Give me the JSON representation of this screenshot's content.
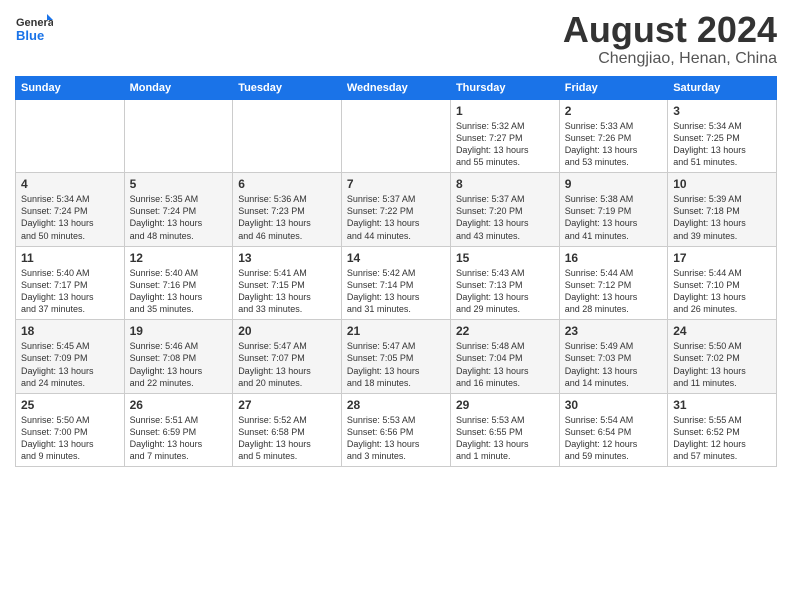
{
  "header": {
    "logo": {
      "general": "General",
      "blue": "Blue"
    },
    "title": "August 2024",
    "location": "Chengjiao, Henan, China"
  },
  "weekdays": [
    "Sunday",
    "Monday",
    "Tuesday",
    "Wednesday",
    "Thursday",
    "Friday",
    "Saturday"
  ],
  "weeks": [
    [
      {
        "day": "",
        "info": ""
      },
      {
        "day": "",
        "info": ""
      },
      {
        "day": "",
        "info": ""
      },
      {
        "day": "",
        "info": ""
      },
      {
        "day": "1",
        "info": "Sunrise: 5:32 AM\nSunset: 7:27 PM\nDaylight: 13 hours\nand 55 minutes."
      },
      {
        "day": "2",
        "info": "Sunrise: 5:33 AM\nSunset: 7:26 PM\nDaylight: 13 hours\nand 53 minutes."
      },
      {
        "day": "3",
        "info": "Sunrise: 5:34 AM\nSunset: 7:25 PM\nDaylight: 13 hours\nand 51 minutes."
      }
    ],
    [
      {
        "day": "4",
        "info": "Sunrise: 5:34 AM\nSunset: 7:24 PM\nDaylight: 13 hours\nand 50 minutes."
      },
      {
        "day": "5",
        "info": "Sunrise: 5:35 AM\nSunset: 7:24 PM\nDaylight: 13 hours\nand 48 minutes."
      },
      {
        "day": "6",
        "info": "Sunrise: 5:36 AM\nSunset: 7:23 PM\nDaylight: 13 hours\nand 46 minutes."
      },
      {
        "day": "7",
        "info": "Sunrise: 5:37 AM\nSunset: 7:22 PM\nDaylight: 13 hours\nand 44 minutes."
      },
      {
        "day": "8",
        "info": "Sunrise: 5:37 AM\nSunset: 7:20 PM\nDaylight: 13 hours\nand 43 minutes."
      },
      {
        "day": "9",
        "info": "Sunrise: 5:38 AM\nSunset: 7:19 PM\nDaylight: 13 hours\nand 41 minutes."
      },
      {
        "day": "10",
        "info": "Sunrise: 5:39 AM\nSunset: 7:18 PM\nDaylight: 13 hours\nand 39 minutes."
      }
    ],
    [
      {
        "day": "11",
        "info": "Sunrise: 5:40 AM\nSunset: 7:17 PM\nDaylight: 13 hours\nand 37 minutes."
      },
      {
        "day": "12",
        "info": "Sunrise: 5:40 AM\nSunset: 7:16 PM\nDaylight: 13 hours\nand 35 minutes."
      },
      {
        "day": "13",
        "info": "Sunrise: 5:41 AM\nSunset: 7:15 PM\nDaylight: 13 hours\nand 33 minutes."
      },
      {
        "day": "14",
        "info": "Sunrise: 5:42 AM\nSunset: 7:14 PM\nDaylight: 13 hours\nand 31 minutes."
      },
      {
        "day": "15",
        "info": "Sunrise: 5:43 AM\nSunset: 7:13 PM\nDaylight: 13 hours\nand 29 minutes."
      },
      {
        "day": "16",
        "info": "Sunrise: 5:44 AM\nSunset: 7:12 PM\nDaylight: 13 hours\nand 28 minutes."
      },
      {
        "day": "17",
        "info": "Sunrise: 5:44 AM\nSunset: 7:10 PM\nDaylight: 13 hours\nand 26 minutes."
      }
    ],
    [
      {
        "day": "18",
        "info": "Sunrise: 5:45 AM\nSunset: 7:09 PM\nDaylight: 13 hours\nand 24 minutes."
      },
      {
        "day": "19",
        "info": "Sunrise: 5:46 AM\nSunset: 7:08 PM\nDaylight: 13 hours\nand 22 minutes."
      },
      {
        "day": "20",
        "info": "Sunrise: 5:47 AM\nSunset: 7:07 PM\nDaylight: 13 hours\nand 20 minutes."
      },
      {
        "day": "21",
        "info": "Sunrise: 5:47 AM\nSunset: 7:05 PM\nDaylight: 13 hours\nand 18 minutes."
      },
      {
        "day": "22",
        "info": "Sunrise: 5:48 AM\nSunset: 7:04 PM\nDaylight: 13 hours\nand 16 minutes."
      },
      {
        "day": "23",
        "info": "Sunrise: 5:49 AM\nSunset: 7:03 PM\nDaylight: 13 hours\nand 14 minutes."
      },
      {
        "day": "24",
        "info": "Sunrise: 5:50 AM\nSunset: 7:02 PM\nDaylight: 13 hours\nand 11 minutes."
      }
    ],
    [
      {
        "day": "25",
        "info": "Sunrise: 5:50 AM\nSunset: 7:00 PM\nDaylight: 13 hours\nand 9 minutes."
      },
      {
        "day": "26",
        "info": "Sunrise: 5:51 AM\nSunset: 6:59 PM\nDaylight: 13 hours\nand 7 minutes."
      },
      {
        "day": "27",
        "info": "Sunrise: 5:52 AM\nSunset: 6:58 PM\nDaylight: 13 hours\nand 5 minutes."
      },
      {
        "day": "28",
        "info": "Sunrise: 5:53 AM\nSunset: 6:56 PM\nDaylight: 13 hours\nand 3 minutes."
      },
      {
        "day": "29",
        "info": "Sunrise: 5:53 AM\nSunset: 6:55 PM\nDaylight: 13 hours\nand 1 minute."
      },
      {
        "day": "30",
        "info": "Sunrise: 5:54 AM\nSunset: 6:54 PM\nDaylight: 12 hours\nand 59 minutes."
      },
      {
        "day": "31",
        "info": "Sunrise: 5:55 AM\nSunset: 6:52 PM\nDaylight: 12 hours\nand 57 minutes."
      }
    ]
  ]
}
